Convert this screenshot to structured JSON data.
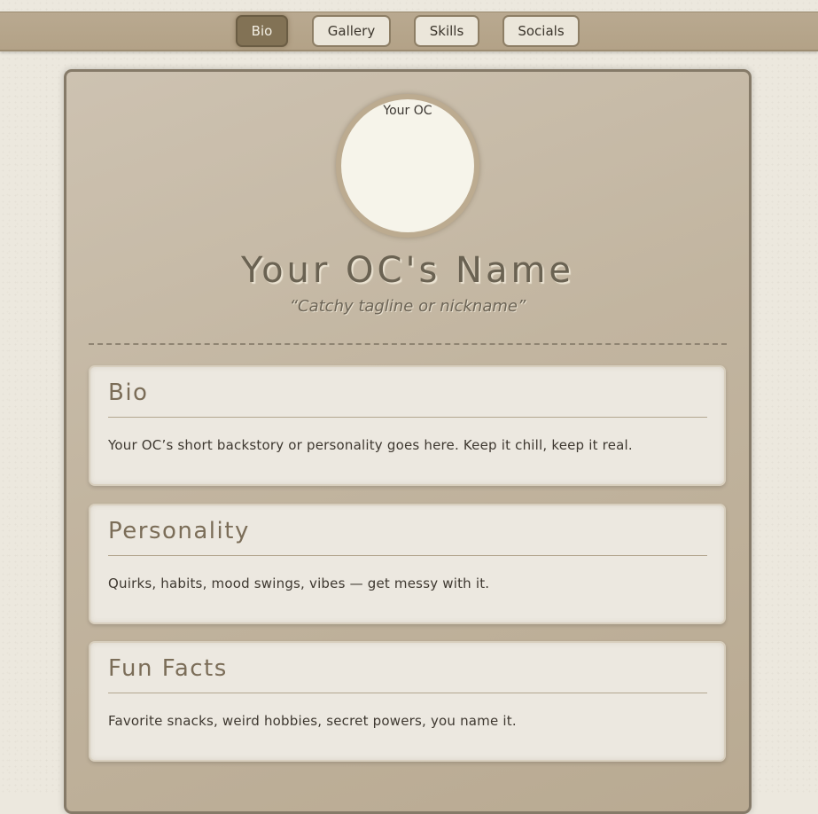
{
  "nav": {
    "items": [
      {
        "label": "Bio",
        "active": true
      },
      {
        "label": "Gallery",
        "active": false
      },
      {
        "label": "Skills",
        "active": false
      },
      {
        "label": "Socials",
        "active": false
      }
    ]
  },
  "profile": {
    "avatar_text": "Your OC",
    "name": "Your OC's Name",
    "tagline": "“Catchy tagline or nickname”"
  },
  "sections": [
    {
      "title": "Bio",
      "text": "Your OC’s short backstory or personality goes here. Keep it chill, keep it real."
    },
    {
      "title": "Personality",
      "text": "Quirks, habits, mood swings, vibes — get messy with it."
    },
    {
      "title": "Fun Facts",
      "text": "Favorite snacks, weird hobbies, secret powers, you name it."
    }
  ],
  "colors": {
    "page_bg": "#ece8de",
    "nav_bar": "#b9a990",
    "nav_active": "#827255",
    "card_bg": "#c2b5a0",
    "section_bg": "#ece8e0",
    "heading": "#7b6d58"
  }
}
